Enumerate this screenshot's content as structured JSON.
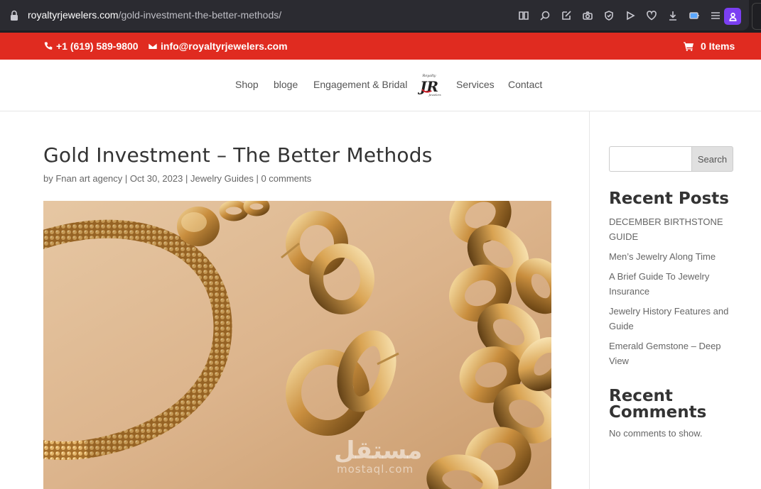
{
  "browser": {
    "url_domain": "royaltyrjewelers.com",
    "url_path": "/gold-investment-the-better-methods/",
    "toolbar_icons": [
      "reader-mode-icon",
      "zoom-icon",
      "edit-icon",
      "camera-icon",
      "shield-icon",
      "play-icon",
      "heart-icon",
      "download-icon",
      "battery-icon",
      "menu-icon"
    ],
    "profile_icon": "profile-icon"
  },
  "topbar": {
    "phone": "+1 (619) 589-9800",
    "email": "info@royaltyrjewelers.com",
    "cart": "0 Items",
    "color": "#e02b20"
  },
  "nav": {
    "items": [
      "Shop",
      "bloge",
      "Engagement & Bridal",
      "Services",
      "Contact"
    ],
    "logo_top": "Royalty",
    "logo_mark": "JR",
    "logo_bottom": "Jewelers"
  },
  "post": {
    "title": "Gold Investment – The Better Methods",
    "meta_prefix": "by ",
    "author": "Fnan art agency",
    "date": "Oct 30, 2023",
    "category": "Jewelry Guides",
    "comments": "0 comments"
  },
  "sidebar": {
    "search_button": "Search",
    "recent_posts_title": "Recent Posts",
    "recent_posts": [
      "DECEMBER BIRTHSTONE GUIDE",
      "Men’s Jewelry Along Time",
      "A Brief Guide To Jewelry Insurance",
      "Jewelry History Features and Guide",
      "Emerald Gemstone – Deep View"
    ],
    "recent_comments_title": "Recent Comments",
    "no_comments": "No comments to show."
  },
  "watermark": {
    "arabic": "مستقل",
    "latin": "mostaql.com"
  }
}
